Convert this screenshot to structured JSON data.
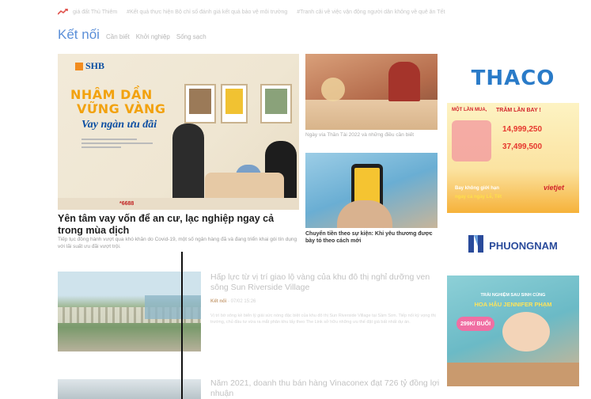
{
  "trending": {
    "items": [
      "giá đất Thủ Thiêm",
      "#Kết quả thực hiện Bộ chỉ số đánh giá kết quả bảo vệ môi trường",
      "#Tranh cãi về việc vận động người dân không về quê ăn Tết"
    ]
  },
  "section": {
    "title": "Kết nối",
    "tabs": [
      "Cần biết",
      "Khởi nghiệp",
      "Sống sạch"
    ]
  },
  "featured": {
    "title": "Yên tâm vay vốn để an cư, lạc nghiệp ngay cả trong mùa dịch",
    "sapo": "Tiếp tục đồng hành vượt qua khó khăn do Covid-19, một số ngân hàng đã và đang triển khai gói tín dụng với lãi suất ưu đãi vượt trội.",
    "image": {
      "brand": "SHB",
      "headline1": "NHÂM DẦN",
      "headline2": "VỮNG VÀNG",
      "headline3": "Vay ngàn ưu đãi",
      "hotline": "*6688"
    }
  },
  "side_items": [
    {
      "caption": "Ngày vía Thần Tài 2022 và những điều cần biết"
    },
    {
      "caption": "Chuyển tiền theo sự kiện: Khi yêu thương được bày tỏ theo cách mới"
    }
  ],
  "list_items": [
    {
      "title": "Hấp lực từ vị trí giao lộ vàng của khu đô thị nghỉ dưỡng ven sông Sun Riverside Village",
      "category": "Kết nối",
      "time": "- 07/02 15:26",
      "sapo": "Vị trí bờ sông kề biển lý giải sức nóng đặc biệt của khu đô thị Sun Riverside Village tại Sầm Sơn. Tiếp nối kỳ vọng thị trường, chủ đầu tư vừa ra mắt phân khu lấy theo The Link sở hữu những ưu thế đặt giá bất nhất dự án."
    },
    {
      "title": "Năm 2021, doanh thu bán hàng Vinaconex đạt 726 tỷ đồng lợi nhuận"
    }
  ],
  "ads": {
    "thaco": {
      "logo": "THACO",
      "line1": "MỘT LẦN MUA,",
      "line2": "TRĂM LẦN BAY !",
      "price1": "14,999,250",
      "price2": "37,499,500",
      "tagline1": "Bay không giới hạn",
      "tagline2": "ngay cả ngày Lễ, Tết",
      "airline": "vietjet"
    },
    "phuongnam": {
      "logo": "PHUONGNAM"
    },
    "spa": {
      "line1": "TRẢI NGHIỆM SAU SINH CÙNG",
      "line2": "HOA HẬU JENNIFER PHẠM",
      "price": "299K/ BUỔI"
    }
  },
  "colors": {
    "accent": "#5b8fd8",
    "category": "#c9a27a",
    "trend_icon": "#e0524c",
    "thaco_blue": "#2a7bc8",
    "shb_orange": "#f28c1e"
  }
}
